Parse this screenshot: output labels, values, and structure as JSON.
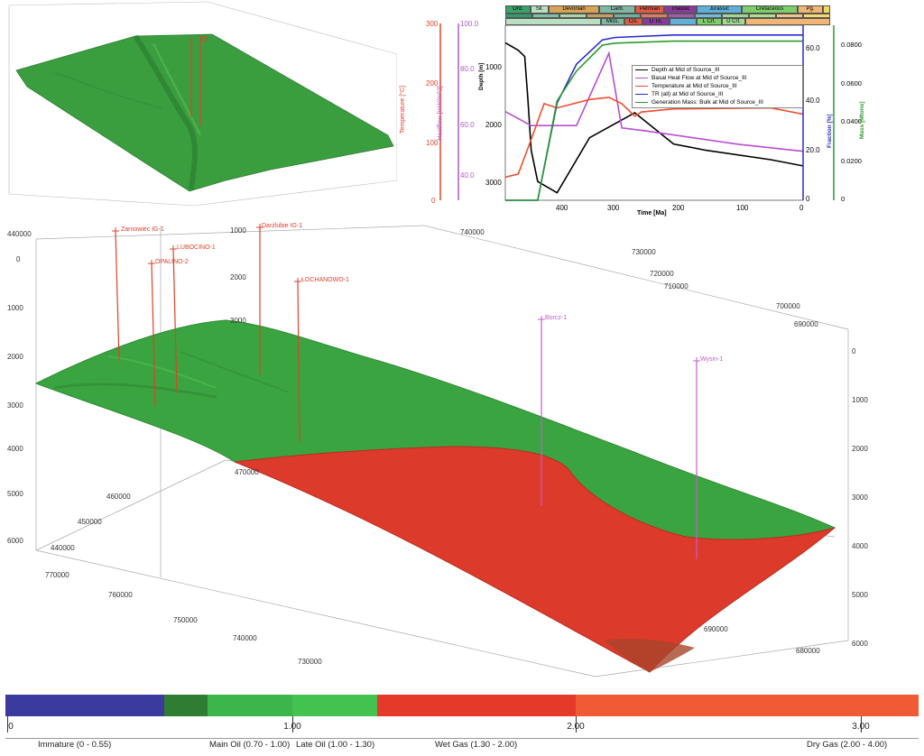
{
  "top_axes": {
    "temperature": {
      "label": "Temperature [°C]",
      "ticks": [
        "300",
        "200",
        "100",
        "0"
      ],
      "color": "#e8402a"
    },
    "heatflow": {
      "label": "Heatflow [mW/m^2]",
      "ticks": [
        "100.0",
        "80.0",
        "60.0",
        "40.0"
      ],
      "color": "#b05cc8"
    }
  },
  "chart": {
    "periods_top": [
      "Ord.",
      "Sil.",
      "Devonian",
      "Carb.",
      "Permian",
      "Triassic",
      "Jurassic",
      "Cretaceous",
      "Pg."
    ],
    "periods_bottom": [
      "Miss.",
      "Cis.",
      "U Tri.",
      "L Crt.",
      "U Crt."
    ],
    "xlabel": "Time [Ma]",
    "ylabel_left": "Depth [m]",
    "ylabel_right1": "Fraction [%]",
    "ylabel_right2": "Mass [Mtons]",
    "x_ticks": [
      "400",
      "300",
      "200",
      "100",
      "0"
    ],
    "y_ticks_left": [
      "1000",
      "2000",
      "3000"
    ],
    "y_ticks_fraction": [
      "60.0",
      "40.0",
      "20.0",
      "0"
    ],
    "y_ticks_mass": [
      "0.0800",
      "0.0600",
      "0.0400",
      "0.0200",
      "0"
    ],
    "legend": [
      {
        "label": "Depth at Mid of Source_III",
        "color": "#000000"
      },
      {
        "label": "Basal Heat Flow at Mid of Source_III",
        "color": "#b74fd0"
      },
      {
        "label": "Temperature at Mid of Source_III",
        "color": "#ef4e2e"
      },
      {
        "label": "TR (all) at Mid of Source_III",
        "color": "#2a2ad0"
      },
      {
        "label": "Generation Mass: Bulk at Mid of Source_III",
        "color": "#2b9a2b"
      }
    ]
  },
  "chart_data": {
    "type": "line",
    "xlim": [
      460,
      0
    ],
    "series": [
      {
        "name": "Depth at Mid of Source_III",
        "x": [
          460,
          440,
          430,
          425,
          420,
          410,
          380,
          330,
          260,
          200,
          150,
          50,
          0
        ],
        "values": [
          780,
          900,
          1000,
          1700,
          2500,
          3000,
          3180,
          2300,
          1900,
          2400,
          2500,
          2650,
          2750
        ]
      },
      {
        "name": "Basal Heat Flow at Mid of Source_III",
        "x": [
          460,
          420,
          380,
          350,
          300,
          280,
          250,
          200,
          100,
          0
        ],
        "values": [
          68,
          62,
          62,
          62,
          93,
          61,
          60,
          58,
          54,
          51
        ]
      },
      {
        "name": "Temperature at Mid of Source_III",
        "x": [
          460,
          440,
          420,
          400,
          380,
          330,
          300,
          280,
          260,
          250,
          200,
          50,
          0
        ],
        "values": [
          22,
          25,
          58,
          92,
          88,
          96,
          98,
          92,
          80,
          84,
          87,
          88,
          82
        ]
      },
      {
        "name": "TR (all) at Mid of Source_III",
        "x": [
          460,
          410,
          380,
          350,
          310,
          290,
          200,
          0
        ],
        "values": [
          0,
          0,
          40,
          56,
          66,
          67,
          68,
          68
        ]
      },
      {
        "name": "Generation Mass: Bulk at Mid of Source_III",
        "x": [
          460,
          410,
          380,
          350,
          310,
          290,
          200,
          0
        ],
        "values": [
          0,
          0,
          0.05,
          0.065,
          0.078,
          0.079,
          0.08,
          0.08
        ]
      }
    ]
  },
  "wells": [
    "Zarnowiec IG-1",
    "LUBOCINO-1",
    "OPALINO-2",
    "Darżlubie IG-1",
    "ŁOCHANOWO-1",
    "Borcz-1",
    "Wysin-1"
  ],
  "axis3d": {
    "depth_left": [
      "0",
      "1000",
      "2000",
      "3000",
      "4000",
      "5000",
      "6000"
    ],
    "depth_right": [
      "0",
      "1000",
      "2000",
      "3000",
      "4000",
      "5000",
      "6000"
    ],
    "y_coords": [
      "440000",
      "450000",
      "460000",
      "470000"
    ],
    "x_coords_top": [
      "740000",
      "730000",
      "720000",
      "710000",
      "700000",
      "690000"
    ],
    "x_coords_bottom": [
      "770000",
      "760000",
      "750000",
      "740000",
      "730000"
    ],
    "x_coords_mid": [
      "690000",
      "680000"
    ],
    "inner_depth": [
      "1000",
      "2000",
      "3000"
    ]
  },
  "colorbar": {
    "segments": [
      {
        "label": "Immature (0 - 0.55)",
        "color": "#3b3b9e"
      },
      {
        "label": "",
        "color": "#2e7d32"
      },
      {
        "label": "Main Oil (0.70 - 1.00)",
        "color": "#3cb64a"
      },
      {
        "label": "Late Oil (1.00 - 1.30)",
        "color": "#43c24f"
      },
      {
        "label": "Wet Gas (1.30 - 2.00)",
        "color": "#e53a2a"
      },
      {
        "label": "Dry Gas (2.00 - 4.00)",
        "color": "#f05a35"
      }
    ],
    "ticks": [
      "0",
      "1.00",
      "2.00",
      "3.00"
    ]
  }
}
